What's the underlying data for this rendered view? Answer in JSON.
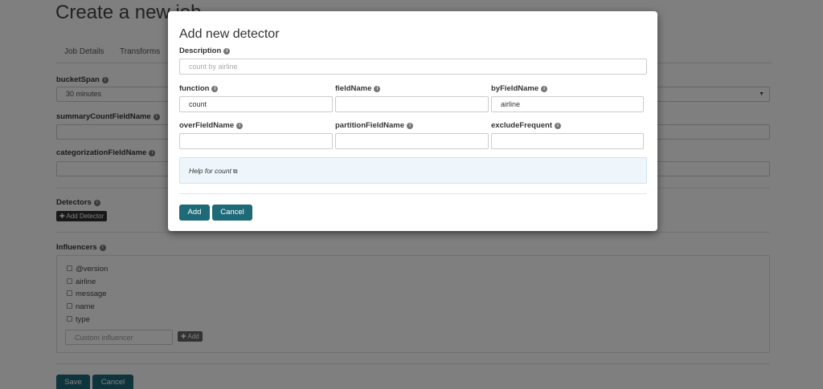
{
  "page": {
    "title": "Create a new job",
    "tabs": [
      {
        "label": "Job Details"
      },
      {
        "label": "Transforms"
      }
    ],
    "fields": {
      "bucket_span": {
        "label": "bucketSpan",
        "value": "30 minutes"
      },
      "summary_count": {
        "label": "summaryCountFieldName",
        "value": ""
      },
      "categorization": {
        "label": "categorizationFieldName",
        "value": ""
      }
    },
    "detectors": {
      "label": "Detectors",
      "add_button": "Add Detector"
    },
    "influencers": {
      "label": "Influencers",
      "items": [
        "@version",
        "airline",
        "message",
        "name",
        "type"
      ],
      "custom_placeholder": "Custom influencer",
      "add_button": "Add"
    },
    "save_button": "Save",
    "cancel_button": "Cancel"
  },
  "modal": {
    "title": "Add new detector",
    "description": {
      "label": "Description",
      "placeholder": "count by airline"
    },
    "function": {
      "label": "function",
      "value": "count"
    },
    "field_name": {
      "label": "fieldName",
      "value": ""
    },
    "by_field_name": {
      "label": "byFieldName",
      "value": "airline"
    },
    "over_field_name": {
      "label": "overFieldName",
      "value": ""
    },
    "partition_field_name": {
      "label": "partitionFieldName",
      "value": ""
    },
    "exclude_frequent": {
      "label": "excludeFrequent",
      "value": ""
    },
    "help_link": "Help for count",
    "add_button": "Add",
    "cancel_button": "Cancel"
  },
  "colors": {
    "primary_button": "#1f6a78",
    "help_background": "#eef6fb",
    "backdrop": "rgba(0,0,0,0.5)"
  },
  "icons": [
    "info-icon",
    "external-link-icon",
    "plus-icon",
    "chevron-down-icon",
    "checkbox-icon"
  ]
}
